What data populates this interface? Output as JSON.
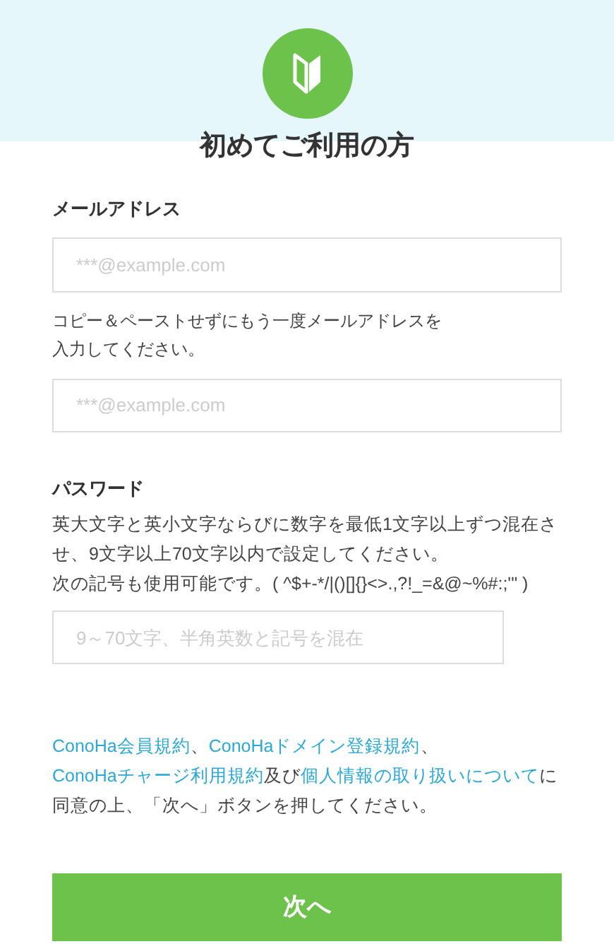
{
  "title": "初めてご利用の方",
  "email": {
    "label": "メールアドレス",
    "placeholder": "***@example.com"
  },
  "email_note": [
    "コピー＆ペーストせずにもう一度メールアドレスを",
    "入力してください。"
  ],
  "email_confirm": {
    "placeholder": "***@example.com"
  },
  "password": {
    "label": "パスワード",
    "description": [
      "英大文字と英小文字ならびに数字を最低1文字以上ずつ混在させ、9文字以上70文字以内で設定してください。",
      "次の記号も使用可能です。( ^$+-*/|()[]{}<>.,?!_=&@~%#:;'\" )"
    ],
    "placeholder": "9～70文字、半角英数と記号を混在"
  },
  "agreement": [
    {
      "kind": "link",
      "text": "ConoHa会員規約"
    },
    {
      "kind": "text",
      "text": "、"
    },
    {
      "kind": "link",
      "text": "ConoHaドメイン登録規約"
    },
    {
      "kind": "text",
      "text": "、"
    },
    {
      "kind": "link",
      "text": "ConoHaチャージ利用規約"
    },
    {
      "kind": "text",
      "text": "及び"
    },
    {
      "kind": "link",
      "text": "個人情報の取り扱いについて"
    },
    {
      "kind": "text",
      "text": "に同意の上、「次へ」ボタンを押してください。"
    }
  ],
  "next_button": "次へ"
}
